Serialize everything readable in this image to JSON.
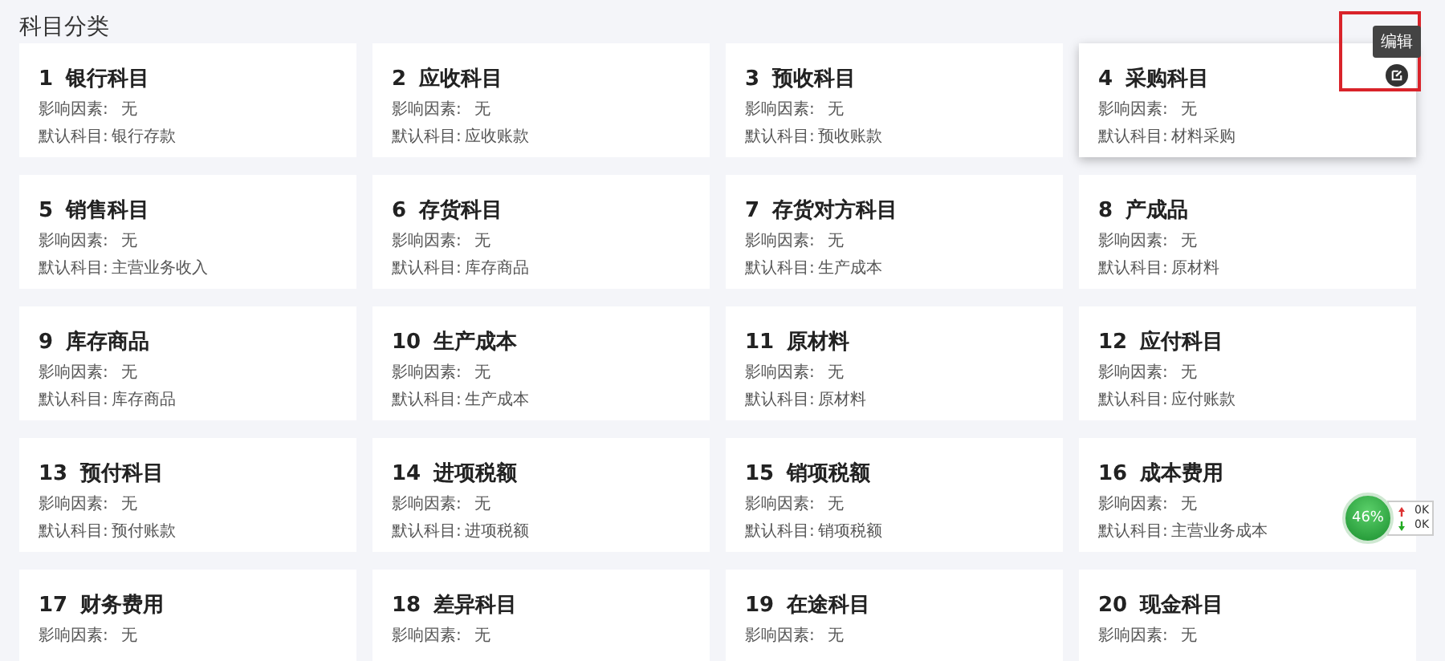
{
  "title": "科目分类",
  "cards": [
    {
      "index": "1",
      "name": "银行科目",
      "factor_label": "影响因素:",
      "factor": "无",
      "default_label": "默认科目:",
      "default": "银行存款",
      "hovered": false
    },
    {
      "index": "2",
      "name": "应收科目",
      "factor_label": "影响因素:",
      "factor": "无",
      "default_label": "默认科目:",
      "default": "应收账款",
      "hovered": false
    },
    {
      "index": "3",
      "name": "预收科目",
      "factor_label": "影响因素:",
      "factor": "无",
      "default_label": "默认科目:",
      "default": "预收账款",
      "hovered": false
    },
    {
      "index": "4",
      "name": "采购科目",
      "factor_label": "影响因素:",
      "factor": "无",
      "default_label": "默认科目:",
      "default": "材料采购",
      "hovered": true
    },
    {
      "index": "5",
      "name": "销售科目",
      "factor_label": "影响因素:",
      "factor": "无",
      "default_label": "默认科目:",
      "default": "主营业务收入",
      "hovered": false
    },
    {
      "index": "6",
      "name": "存货科目",
      "factor_label": "影响因素:",
      "factor": "无",
      "default_label": "默认科目:",
      "default": "库存商品",
      "hovered": false
    },
    {
      "index": "7",
      "name": "存货对方科目",
      "factor_label": "影响因素:",
      "factor": "无",
      "default_label": "默认科目:",
      "default": "生产成本",
      "hovered": false
    },
    {
      "index": "8",
      "name": "产成品",
      "factor_label": "影响因素:",
      "factor": "无",
      "default_label": "默认科目:",
      "default": "原材料",
      "hovered": false
    },
    {
      "index": "9",
      "name": "库存商品",
      "factor_label": "影响因素:",
      "factor": "无",
      "default_label": "默认科目:",
      "default": "库存商品",
      "hovered": false
    },
    {
      "index": "10",
      "name": "生产成本",
      "factor_label": "影响因素:",
      "factor": "无",
      "default_label": "默认科目:",
      "default": "生产成本",
      "hovered": false
    },
    {
      "index": "11",
      "name": "原材料",
      "factor_label": "影响因素:",
      "factor": "无",
      "default_label": "默认科目:",
      "default": "原材料",
      "hovered": false
    },
    {
      "index": "12",
      "name": "应付科目",
      "factor_label": "影响因素:",
      "factor": "无",
      "default_label": "默认科目:",
      "default": "应付账款",
      "hovered": false
    },
    {
      "index": "13",
      "name": "预付科目",
      "factor_label": "影响因素:",
      "factor": "无",
      "default_label": "默认科目:",
      "default": "预付账款",
      "hovered": false
    },
    {
      "index": "14",
      "name": "进项税额",
      "factor_label": "影响因素:",
      "factor": "无",
      "default_label": "默认科目:",
      "default": "进项税额",
      "hovered": false
    },
    {
      "index": "15",
      "name": "销项税额",
      "factor_label": "影响因素:",
      "factor": "无",
      "default_label": "默认科目:",
      "default": "销项税额",
      "hovered": false
    },
    {
      "index": "16",
      "name": "成本费用",
      "factor_label": "影响因素:",
      "factor": "无",
      "default_label": "默认科目:",
      "default": "主营业务成本",
      "hovered": false
    },
    {
      "index": "17",
      "name": "财务费用",
      "factor_label": "影响因素:",
      "factor": "无",
      "hovered": false
    },
    {
      "index": "18",
      "name": "差异科目",
      "factor_label": "影响因素:",
      "factor": "无",
      "hovered": false
    },
    {
      "index": "19",
      "name": "在途科目",
      "factor_label": "影响因素:",
      "factor": "无",
      "hovered": false
    },
    {
      "index": "20",
      "name": "现金科目",
      "factor_label": "影响因素:",
      "factor": "无",
      "hovered": false
    }
  ],
  "tooltip": "编辑",
  "speed_widget": {
    "percent": "46%",
    "upload": "0K",
    "download": "0K"
  }
}
